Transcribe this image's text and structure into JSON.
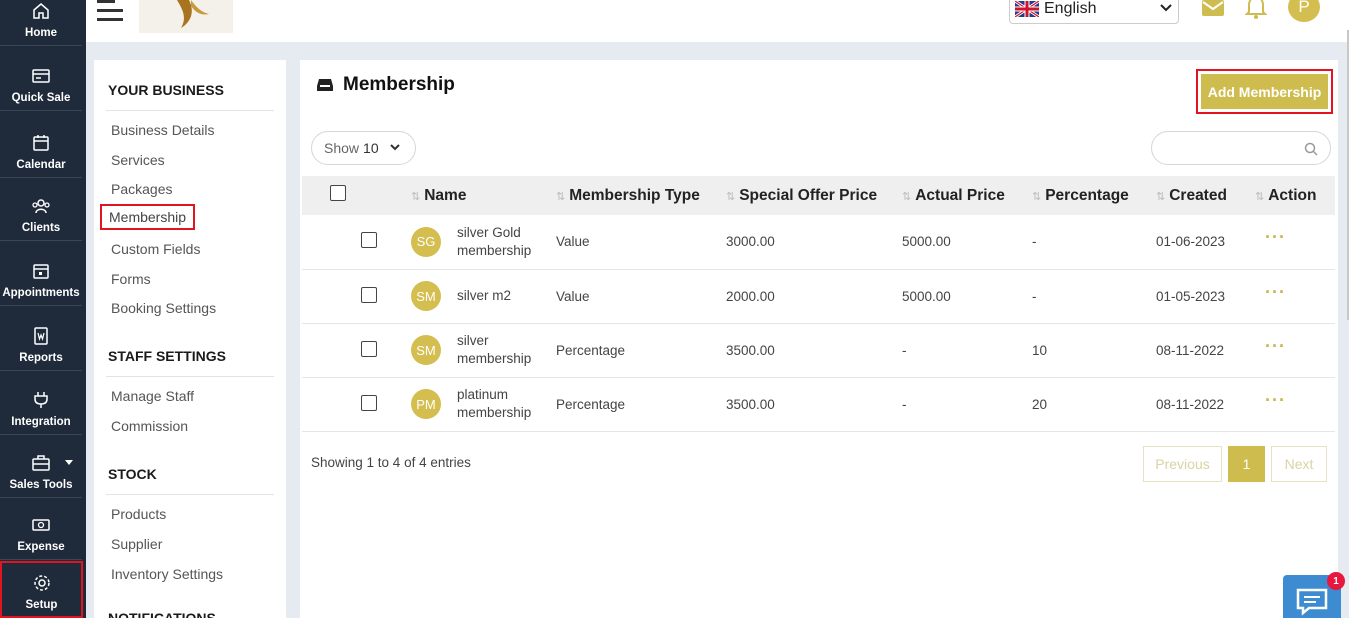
{
  "nav": [
    {
      "label": "Home",
      "icon": "home-icon"
    },
    {
      "label": "Quick Sale",
      "icon": "quick-sale-icon"
    },
    {
      "label": "Calendar",
      "icon": "calendar-icon"
    },
    {
      "label": "Clients",
      "icon": "clients-icon"
    },
    {
      "label": "Appointments",
      "icon": "appointments-icon"
    },
    {
      "label": "Reports",
      "icon": "reports-icon"
    },
    {
      "label": "Integration",
      "icon": "plug-icon"
    },
    {
      "label": "Sales Tools",
      "icon": "briefcase-icon"
    },
    {
      "label": "Expense",
      "icon": "money-icon"
    },
    {
      "label": "Setup",
      "icon": "gear-icon"
    }
  ],
  "topbar": {
    "language": "English"
  },
  "top_avatar": "P",
  "submenu": {
    "your_business": {
      "title": "YOUR BUSINESS",
      "items": [
        "Business Details",
        "Services",
        "Packages",
        "Membership",
        "Custom Fields",
        "Forms",
        "Booking Settings"
      ]
    },
    "staff_settings": {
      "title": "STAFF SETTINGS",
      "items": [
        "Manage Staff",
        "Commission"
      ]
    },
    "stock": {
      "title": "STOCK",
      "items": [
        "Products",
        "Supplier",
        "Inventory Settings"
      ]
    },
    "notifications": {
      "title": "NOTIFICATIONS"
    }
  },
  "main": {
    "title": "Membership",
    "add_button": "Add Membership",
    "show_label": "Show",
    "show_value": "10",
    "search_placeholder": "",
    "columns": [
      "Name",
      "Membership Type",
      "Special Offer Price",
      "Actual Price",
      "Percentage",
      "Created",
      "Action"
    ],
    "rows": [
      {
        "initials": "SG",
        "name": "silver Gold membership",
        "type": "Value",
        "special_price": "3000.00",
        "actual_price": "5000.00",
        "percentage": "-",
        "created": "01-06-2023",
        "action": "···"
      },
      {
        "initials": "SM",
        "name": "silver m2",
        "type": "Value",
        "special_price": "2000.00",
        "actual_price": "5000.00",
        "percentage": "-",
        "created": "01-05-2023",
        "action": "···"
      },
      {
        "initials": "SM",
        "name": "silver membership",
        "type": "Percentage",
        "special_price": "3500.00",
        "actual_price": "-",
        "percentage": "10",
        "created": "08-11-2022",
        "action": "···"
      },
      {
        "initials": "PM",
        "name": "platinum membership",
        "type": "Percentage",
        "special_price": "3500.00",
        "actual_price": "-",
        "percentage": "20",
        "created": "08-11-2022",
        "action": "···"
      }
    ],
    "entries_text": "Showing 1 to 4 of 4 entries",
    "pagination": {
      "previous": "Previous",
      "current": "1",
      "next": "Next"
    }
  },
  "chat_badge": "1",
  "colors": {
    "sidebar": "#1f2a3a",
    "accent": "#cfbc4e",
    "highlight": "#e0151f"
  }
}
